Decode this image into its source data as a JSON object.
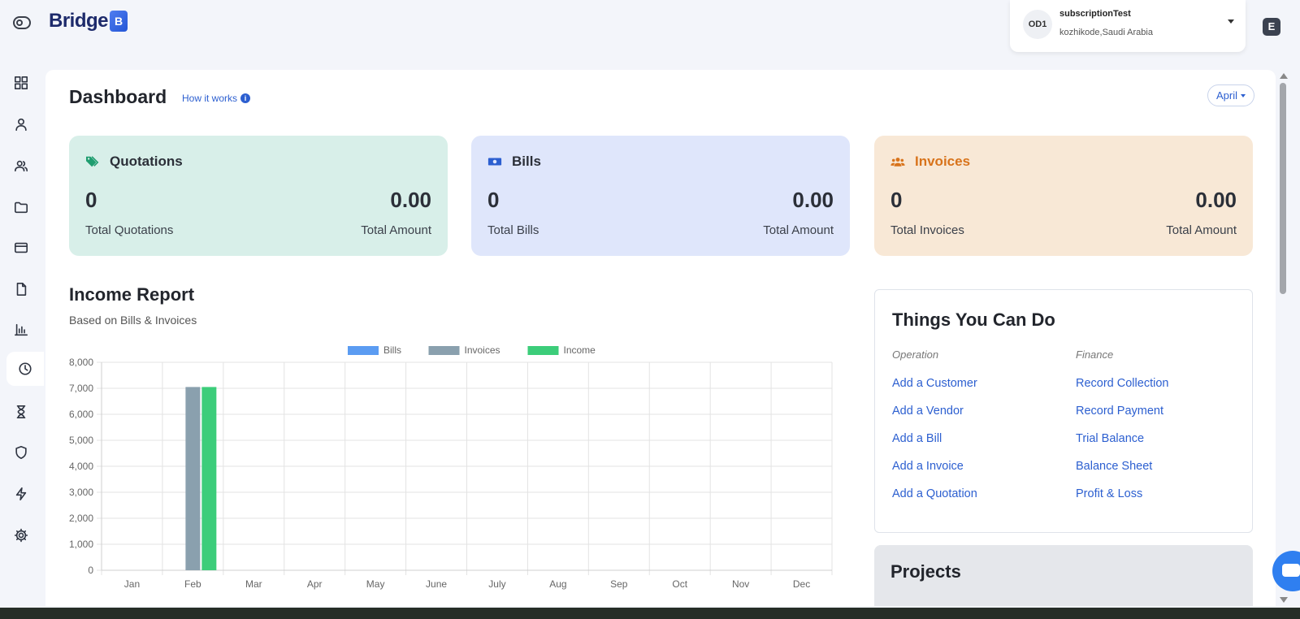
{
  "brand": {
    "logo_text": "Bridge",
    "logo_mark": "B"
  },
  "account": {
    "avatar_initials": "OD1",
    "name": "subscriptionTest",
    "location": "kozhikode,Saudi Arabia"
  },
  "sidebar": {
    "items": [
      {
        "icon": "dashboard-grid-icon"
      },
      {
        "icon": "user-icon"
      },
      {
        "icon": "users-icon"
      },
      {
        "icon": "folder-icon"
      },
      {
        "icon": "credit-card-icon"
      },
      {
        "icon": "document-icon"
      },
      {
        "icon": "bar-chart-icon"
      },
      {
        "icon": "clock-icon",
        "active": true
      },
      {
        "icon": "hourglass-icon"
      },
      {
        "icon": "shield-icon"
      },
      {
        "icon": "lightning-icon"
      },
      {
        "icon": "gear-icon"
      }
    ]
  },
  "header": {
    "title": "Dashboard",
    "how_it_works": "How it works",
    "month": "April"
  },
  "cards": {
    "quotations": {
      "title": "Quotations",
      "count": "0",
      "amount": "0.00",
      "count_label": "Total Quotations",
      "amount_label": "Total Amount",
      "color": "#d8efe9",
      "icon": "tags-icon"
    },
    "bills": {
      "title": "Bills",
      "count": "0",
      "amount": "0.00",
      "count_label": "Total Bills",
      "amount_label": "Total Amount",
      "color": "#dfe6fb",
      "icon": "money-bill-icon"
    },
    "invoices": {
      "title": "Invoices",
      "count": "0",
      "amount": "0.00",
      "count_label": "Total Invoices",
      "amount_label": "Total Amount",
      "color": "#f8e8d6",
      "icon": "users-group-icon"
    }
  },
  "income_report": {
    "title": "Income Report",
    "subtitle": "Based on Bills & Invoices"
  },
  "chart_data": {
    "type": "bar",
    "categories": [
      "Jan",
      "Feb",
      "Mar",
      "Apr",
      "May",
      "June",
      "July",
      "Aug",
      "Sep",
      "Oct",
      "Nov",
      "Dec"
    ],
    "series": [
      {
        "name": "Bills",
        "color": "#5b9cf2",
        "values": [
          0,
          0,
          0,
          0,
          0,
          0,
          0,
          0,
          0,
          0,
          0,
          0
        ]
      },
      {
        "name": "Invoices",
        "color": "#8aa0ae",
        "values": [
          0,
          7050,
          0,
          0,
          0,
          0,
          0,
          0,
          0,
          0,
          0,
          0
        ]
      },
      {
        "name": "Income",
        "color": "#3ccd7a",
        "values": [
          0,
          7050,
          0,
          0,
          0,
          0,
          0,
          0,
          0,
          0,
          0,
          0
        ]
      }
    ],
    "ylim": [
      0,
      8000
    ],
    "yticks": [
      "0",
      "1,000",
      "2,000",
      "3,000",
      "4,000",
      "5,000",
      "6,000",
      "7,000",
      "8,000"
    ],
    "grid": true,
    "legend": "top-center"
  },
  "things": {
    "title": "Things You Can Do",
    "operation": {
      "caption": "Operation",
      "links": [
        "Add a Customer",
        "Add a Vendor",
        "Add a Bill",
        "Add a Invoice",
        "Add a Quotation"
      ]
    },
    "finance": {
      "caption": "Finance",
      "links": [
        "Record Collection",
        "Record Payment",
        "Trial Balance",
        "Balance Sheet",
        "Profit & Loss"
      ]
    }
  },
  "projects": {
    "title": "Projects"
  },
  "corner_icon": "E"
}
